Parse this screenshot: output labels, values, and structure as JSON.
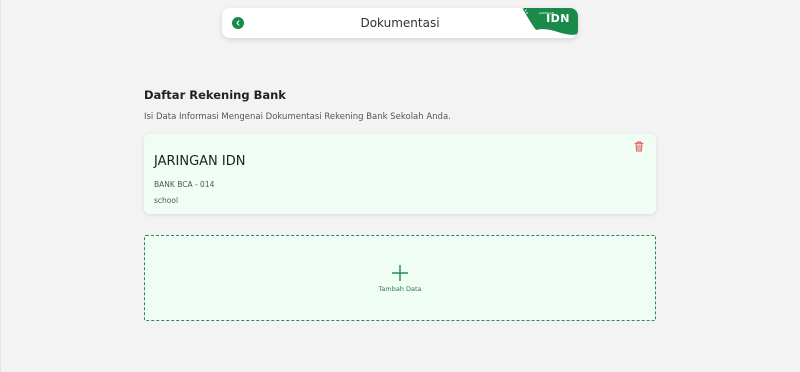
{
  "header": {
    "title": "Dokumentasi",
    "brand_text": "IDN",
    "brand_subtext": "JARINGAN",
    "brand_color": "#1a8a4a"
  },
  "section": {
    "title": "Daftar Rekening Bank",
    "subtitle": "Isi Data Informasi Mengenai Dokumentasi Rekening Bank Sekolah Anda."
  },
  "bank_accounts": [
    {
      "name": "JARINGAN IDN",
      "bank": "BANK BCA - 014",
      "owner": "school"
    }
  ],
  "add_button": {
    "label": "Tambah Data"
  },
  "icons": {
    "back": "chevron-left-icon",
    "delete": "trash-icon",
    "add": "plus-icon",
    "brand": "sun-icon"
  },
  "colors": {
    "accent": "#1a8a4a",
    "card_bg": "#effdf4",
    "delete": "#e05555"
  }
}
